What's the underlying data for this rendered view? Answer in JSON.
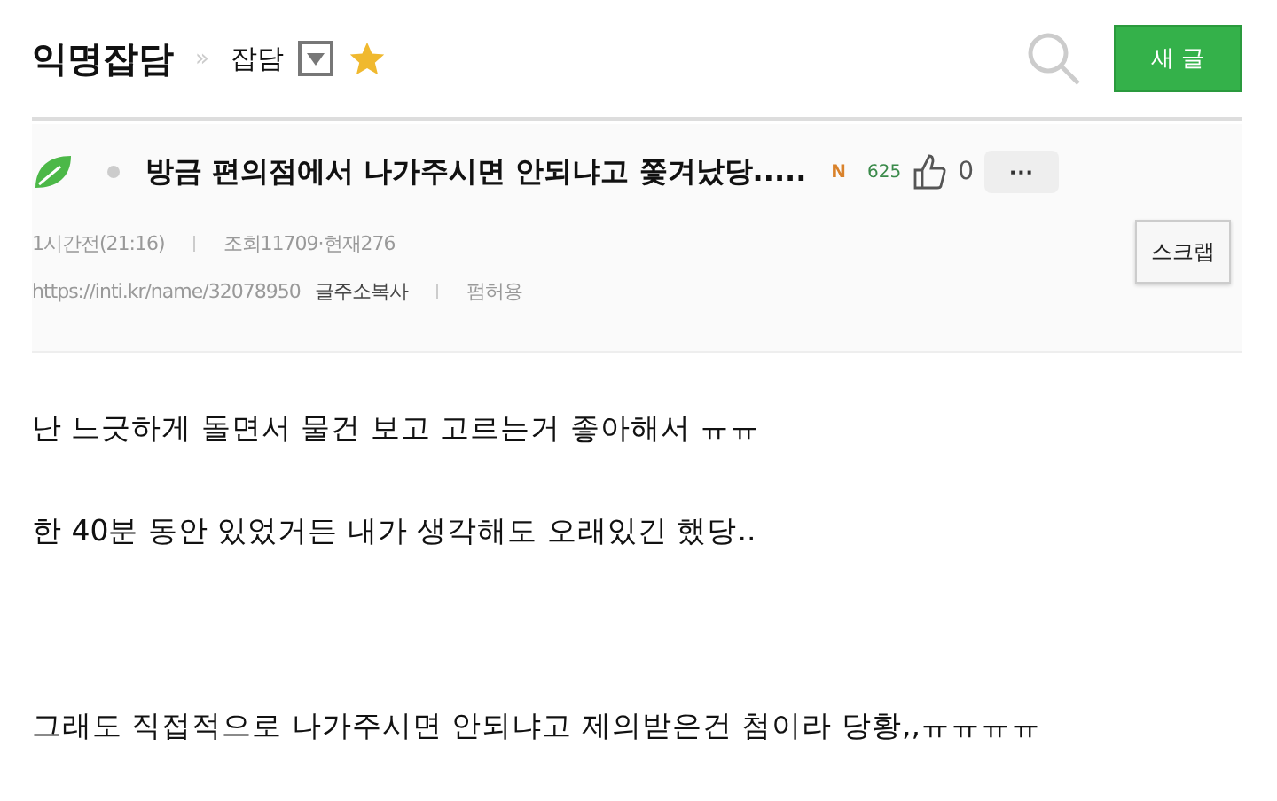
{
  "header": {
    "board": "익명잡담",
    "separator": "»",
    "category": "잡담",
    "new_post_button": "새 글"
  },
  "post": {
    "title": "방금 편의점에서 나가주시면 안되냐고 쫓겨났당.....",
    "badge": "N",
    "count": "625",
    "likes": "0",
    "more": "···",
    "time": "1시간전(21:16)",
    "views": "조회11709·현재276",
    "url": "https://inti.kr/name/32078950",
    "copy_link": "글주소복사",
    "permission": "펌허용",
    "scrap_button": "스크랩"
  },
  "body": [
    "난 느긋하게 돌면서 물건 보고 고르는거 좋아해서 ㅠㅠ",
    "한 40분 동안 있었거든 내가 생각해도 오래있긴 했당..",
    "그래도 직접적으로 나가주시면 안되냐고 제의받은건 첨이라 당황,,ㅠㅠㅠㅠ"
  ]
}
